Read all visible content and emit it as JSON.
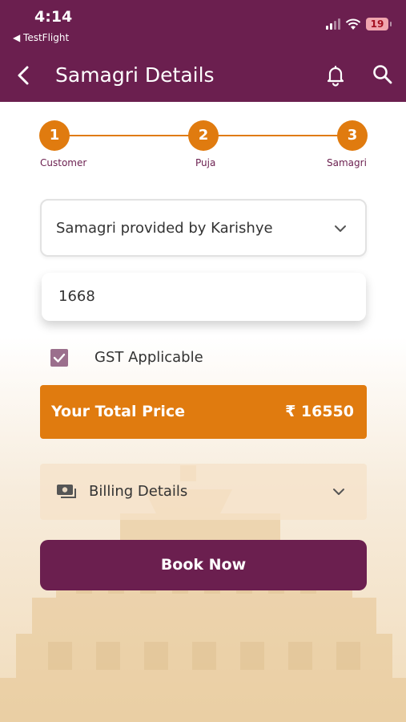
{
  "status_bar": {
    "time": "4:14",
    "back_app": "◀ TestFlight",
    "battery": "19"
  },
  "header": {
    "title": "Samagri Details",
    "back_icon": "back-chevron-icon",
    "bell_icon": "bell-icon",
    "search_icon": "search-icon",
    "color": "#6b1f4f"
  },
  "stepper": {
    "accent": "#e07b0f",
    "steps": [
      {
        "number": "1",
        "label": "Customer"
      },
      {
        "number": "2",
        "label": "Puja"
      },
      {
        "number": "3",
        "label": "Samagri"
      }
    ]
  },
  "samagri_dropdown": {
    "selected": "Samagri provided by Karishye"
  },
  "amount_input": {
    "value": "1668"
  },
  "gst": {
    "label": "GST Applicable",
    "checked": true
  },
  "total": {
    "label": "Your Total Price",
    "value": "₹ 16550"
  },
  "billing": {
    "label": "Billing Details",
    "icon": "money-icon"
  },
  "book_button": {
    "label": "Book Now"
  }
}
